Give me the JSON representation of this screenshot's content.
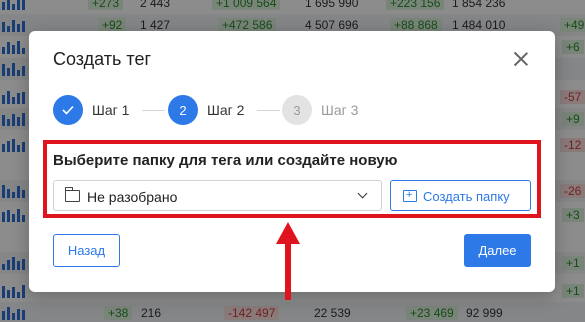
{
  "background": {
    "rows": [
      [
        "+273",
        "2 443",
        "+1 009 564",
        "1 695 990",
        "+223 156",
        "1 854 236"
      ],
      [
        "+92",
        "1 427",
        "+472 586",
        "4 507 696",
        "+88 868",
        "1 484 010",
        "+49"
      ],
      [
        "",
        "",
        "",
        "",
        "",
        "",
        "+6"
      ],
      [
        "",
        "",
        "",
        "",
        "",
        "",
        "-57"
      ],
      [
        "",
        "",
        "",
        "",
        "",
        "",
        "+9"
      ],
      [
        "",
        "",
        "",
        "",
        "",
        "",
        "-12"
      ],
      [
        "",
        "",
        "",
        "",
        "",
        "",
        "-26"
      ],
      [
        "",
        "",
        "",
        "",
        "",
        "",
        "+3"
      ],
      [
        "",
        "",
        "",
        "",
        "",
        "",
        "+1"
      ],
      [
        "",
        "",
        "",
        "",
        "",
        "",
        "+1"
      ],
      [
        "+38",
        "216",
        "-142 497",
        "22 539",
        "+23 469",
        "92 999"
      ]
    ]
  },
  "modal": {
    "title": "Создать тег",
    "steps": [
      {
        "number": "",
        "label": "Шаг 1",
        "state": "done"
      },
      {
        "number": "2",
        "label": "Шаг 2",
        "state": "active"
      },
      {
        "number": "3",
        "label": "Шаг 3",
        "state": "todo"
      }
    ],
    "section_label": "Выберите папку для тега или создайте новую",
    "folder_select": {
      "value": "Не разобрано"
    },
    "create_folder_label": "Создать папку",
    "back_label": "Назад",
    "next_label": "Далее"
  },
  "colors": {
    "accent": "#2d79e8",
    "highlight": "#e0141c"
  }
}
